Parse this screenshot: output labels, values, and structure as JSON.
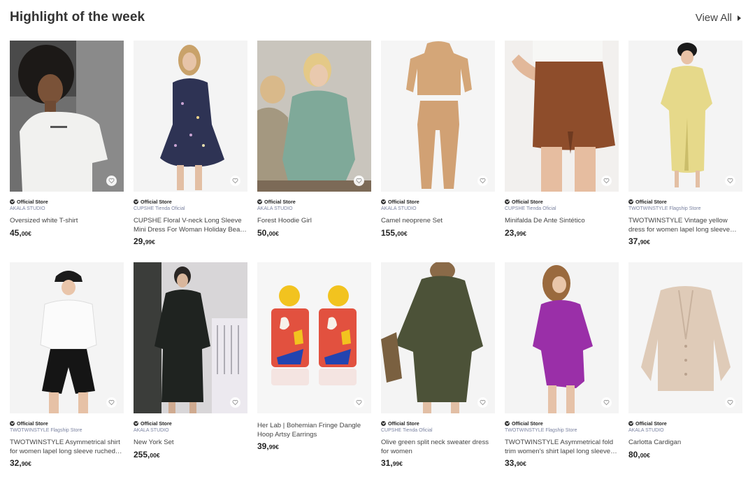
{
  "section": {
    "title": "Highlight of the week",
    "view_all": "View All"
  },
  "badge_label": "Official Store",
  "products": [
    {
      "official": true,
      "store": "AKALA STUDIO",
      "name": "Oversized white T-shirt",
      "price_main": "45,",
      "price_cents": "00€"
    },
    {
      "official": true,
      "store": "CUPSHE Tienda Oficial",
      "name": "CUPSHE Floral V-neck Long Sleeve Mini Dress For Woman Holiday Bea…",
      "price_main": "29,",
      "price_cents": "99€"
    },
    {
      "official": true,
      "store": "AKALA STUDIO",
      "name": "Forest Hoodie Girl",
      "price_main": "50,",
      "price_cents": "00€"
    },
    {
      "official": true,
      "store": "AKALA STUDIO",
      "name": "Camel neoprene Set",
      "price_main": "155,",
      "price_cents": "00€"
    },
    {
      "official": true,
      "store": "CUPSHE Tienda Oficial",
      "name": "Minifalda De Ante Sintético",
      "price_main": "23,",
      "price_cents": "99€"
    },
    {
      "official": true,
      "store": "TWOTWINSTYLE Flagship Store",
      "name": "TWOTWINSTYLE Vintage yellow dress for women lapel long sleeve high…",
      "price_main": "37,",
      "price_cents": "90€"
    },
    {
      "official": true,
      "store": "TWOTWINSTYLE Flagship Store",
      "name": "TWOTWINSTYLE Asymmetrical shirt for women lapel long sleeve ruched…",
      "price_main": "32,",
      "price_cents": "90€"
    },
    {
      "official": true,
      "store": "AKALA STUDIO",
      "name": "New York Set",
      "price_main": "255,",
      "price_cents": "00€"
    },
    {
      "official": false,
      "store": "",
      "name": "Her Lab | Bohemian Fringe Dangle Hoop Artsy Earrings",
      "price_main": "39,",
      "price_cents": "99€"
    },
    {
      "official": true,
      "store": "CUPSHE Tienda Oficial",
      "name": "Olive green split neck sweater dress for women",
      "price_main": "31,",
      "price_cents": "99€"
    },
    {
      "official": true,
      "store": "TWOTWINSTYLE Flagship Store",
      "name": "TWOTWINSTYLE Asymmetrical fold trim women's shirt lapel long sleeve…",
      "price_main": "33,",
      "price_cents": "90€"
    },
    {
      "official": true,
      "store": "AKALA STUDIO",
      "name": "Carlotta Cardigan",
      "price_main": "80,",
      "price_cents": "00€"
    }
  ]
}
